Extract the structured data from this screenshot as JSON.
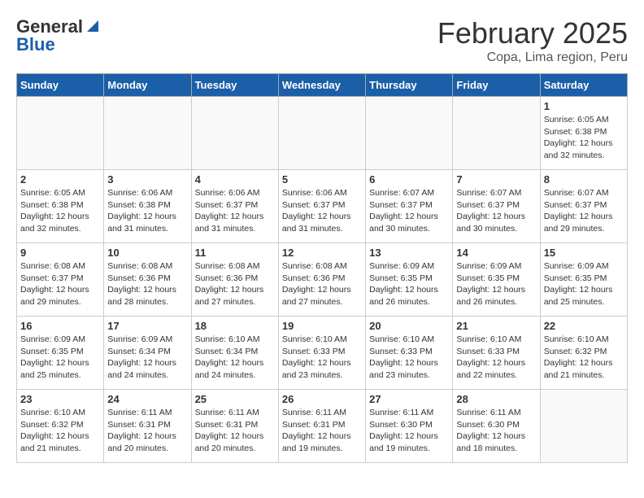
{
  "header": {
    "logo_general": "General",
    "logo_blue": "Blue",
    "title": "February 2025",
    "subtitle": "Copa, Lima region, Peru"
  },
  "days_of_week": [
    "Sunday",
    "Monday",
    "Tuesday",
    "Wednesday",
    "Thursday",
    "Friday",
    "Saturday"
  ],
  "weeks": [
    [
      {
        "day": "",
        "info": ""
      },
      {
        "day": "",
        "info": ""
      },
      {
        "day": "",
        "info": ""
      },
      {
        "day": "",
        "info": ""
      },
      {
        "day": "",
        "info": ""
      },
      {
        "day": "",
        "info": ""
      },
      {
        "day": "1",
        "info": "Sunrise: 6:05 AM\nSunset: 6:38 PM\nDaylight: 12 hours\nand 32 minutes."
      }
    ],
    [
      {
        "day": "2",
        "info": "Sunrise: 6:05 AM\nSunset: 6:38 PM\nDaylight: 12 hours\nand 32 minutes."
      },
      {
        "day": "3",
        "info": "Sunrise: 6:06 AM\nSunset: 6:38 PM\nDaylight: 12 hours\nand 31 minutes."
      },
      {
        "day": "4",
        "info": "Sunrise: 6:06 AM\nSunset: 6:37 PM\nDaylight: 12 hours\nand 31 minutes."
      },
      {
        "day": "5",
        "info": "Sunrise: 6:06 AM\nSunset: 6:37 PM\nDaylight: 12 hours\nand 31 minutes."
      },
      {
        "day": "6",
        "info": "Sunrise: 6:07 AM\nSunset: 6:37 PM\nDaylight: 12 hours\nand 30 minutes."
      },
      {
        "day": "7",
        "info": "Sunrise: 6:07 AM\nSunset: 6:37 PM\nDaylight: 12 hours\nand 30 minutes."
      },
      {
        "day": "8",
        "info": "Sunrise: 6:07 AM\nSunset: 6:37 PM\nDaylight: 12 hours\nand 29 minutes."
      }
    ],
    [
      {
        "day": "9",
        "info": "Sunrise: 6:08 AM\nSunset: 6:37 PM\nDaylight: 12 hours\nand 29 minutes."
      },
      {
        "day": "10",
        "info": "Sunrise: 6:08 AM\nSunset: 6:36 PM\nDaylight: 12 hours\nand 28 minutes."
      },
      {
        "day": "11",
        "info": "Sunrise: 6:08 AM\nSunset: 6:36 PM\nDaylight: 12 hours\nand 27 minutes."
      },
      {
        "day": "12",
        "info": "Sunrise: 6:08 AM\nSunset: 6:36 PM\nDaylight: 12 hours\nand 27 minutes."
      },
      {
        "day": "13",
        "info": "Sunrise: 6:09 AM\nSunset: 6:35 PM\nDaylight: 12 hours\nand 26 minutes."
      },
      {
        "day": "14",
        "info": "Sunrise: 6:09 AM\nSunset: 6:35 PM\nDaylight: 12 hours\nand 26 minutes."
      },
      {
        "day": "15",
        "info": "Sunrise: 6:09 AM\nSunset: 6:35 PM\nDaylight: 12 hours\nand 25 minutes."
      }
    ],
    [
      {
        "day": "16",
        "info": "Sunrise: 6:09 AM\nSunset: 6:35 PM\nDaylight: 12 hours\nand 25 minutes."
      },
      {
        "day": "17",
        "info": "Sunrise: 6:09 AM\nSunset: 6:34 PM\nDaylight: 12 hours\nand 24 minutes."
      },
      {
        "day": "18",
        "info": "Sunrise: 6:10 AM\nSunset: 6:34 PM\nDaylight: 12 hours\nand 24 minutes."
      },
      {
        "day": "19",
        "info": "Sunrise: 6:10 AM\nSunset: 6:33 PM\nDaylight: 12 hours\nand 23 minutes."
      },
      {
        "day": "20",
        "info": "Sunrise: 6:10 AM\nSunset: 6:33 PM\nDaylight: 12 hours\nand 23 minutes."
      },
      {
        "day": "21",
        "info": "Sunrise: 6:10 AM\nSunset: 6:33 PM\nDaylight: 12 hours\nand 22 minutes."
      },
      {
        "day": "22",
        "info": "Sunrise: 6:10 AM\nSunset: 6:32 PM\nDaylight: 12 hours\nand 21 minutes."
      }
    ],
    [
      {
        "day": "23",
        "info": "Sunrise: 6:10 AM\nSunset: 6:32 PM\nDaylight: 12 hours\nand 21 minutes."
      },
      {
        "day": "24",
        "info": "Sunrise: 6:11 AM\nSunset: 6:31 PM\nDaylight: 12 hours\nand 20 minutes."
      },
      {
        "day": "25",
        "info": "Sunrise: 6:11 AM\nSunset: 6:31 PM\nDaylight: 12 hours\nand 20 minutes."
      },
      {
        "day": "26",
        "info": "Sunrise: 6:11 AM\nSunset: 6:31 PM\nDaylight: 12 hours\nand 19 minutes."
      },
      {
        "day": "27",
        "info": "Sunrise: 6:11 AM\nSunset: 6:30 PM\nDaylight: 12 hours\nand 19 minutes."
      },
      {
        "day": "28",
        "info": "Sunrise: 6:11 AM\nSunset: 6:30 PM\nDaylight: 12 hours\nand 18 minutes."
      },
      {
        "day": "",
        "info": ""
      }
    ]
  ]
}
